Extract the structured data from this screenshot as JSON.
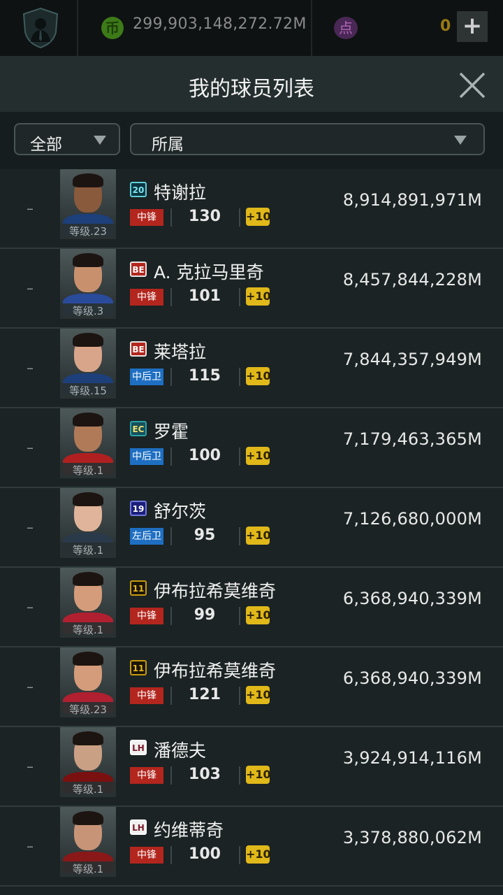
{
  "topbar": {
    "coin_icon_label": "币",
    "coin_value": "299,903,148,272.72M",
    "point_icon_label": "点",
    "point_value": "0",
    "add_label": "+"
  },
  "header": {
    "title": "我的球员列表"
  },
  "filters": {
    "scope_label": "全部",
    "team_label": "所属"
  },
  "icons": {
    "close": "close-icon",
    "dropdown": "triangle-down-icon",
    "profile": "manager-badge-icon"
  },
  "colors": {
    "forward_badge": "#b3261e",
    "defender_badge": "#1e6fc2",
    "upgrade_badge": "#e0b81a"
  },
  "players": [
    {
      "rank": "–",
      "level": "等级.23",
      "season": "20",
      "name": "特谢拉",
      "position": "中锋",
      "position_type": "fw",
      "ovr": "130",
      "upgrade": "+10",
      "value": "8,914,891,971M"
    },
    {
      "rank": "–",
      "level": "等级.3",
      "season": "BE",
      "name": "A. 克拉马里奇",
      "position": "中锋",
      "position_type": "fw",
      "ovr": "101",
      "upgrade": "+10",
      "value": "8,457,844,228M"
    },
    {
      "rank": "–",
      "level": "等级.15",
      "season": "BE",
      "name": "莱塔拉",
      "position": "中后卫",
      "position_type": "df",
      "ovr": "115",
      "upgrade": "+10",
      "value": "7,844,357,949M"
    },
    {
      "rank": "–",
      "level": "等级.1",
      "season": "EC",
      "name": "罗霍",
      "position": "中后卫",
      "position_type": "df",
      "ovr": "100",
      "upgrade": "+10",
      "value": "7,179,463,365M"
    },
    {
      "rank": "–",
      "level": "等级.1",
      "season": "19",
      "name": "舒尔茨",
      "position": "左后卫",
      "position_type": "df",
      "ovr": "95",
      "upgrade": "+10",
      "value": "7,126,680,000M"
    },
    {
      "rank": "–",
      "level": "等级.1",
      "season": "11",
      "name": "伊布拉希莫维奇",
      "position": "中锋",
      "position_type": "fw",
      "ovr": "99",
      "upgrade": "+10",
      "value": "6,368,940,339M"
    },
    {
      "rank": "–",
      "level": "等级.23",
      "season": "11",
      "name": "伊布拉希莫维奇",
      "position": "中锋",
      "position_type": "fw",
      "ovr": "121",
      "upgrade": "+10",
      "value": "6,368,940,339M"
    },
    {
      "rank": "–",
      "level": "等级.1",
      "season": "LH",
      "name": "潘德夫",
      "position": "中锋",
      "position_type": "fw",
      "ovr": "103",
      "upgrade": "+10",
      "value": "3,924,914,116M"
    },
    {
      "rank": "–",
      "level": "等级.1",
      "season": "LH",
      "name": "约维蒂奇",
      "position": "中锋",
      "position_type": "fw",
      "ovr": "100",
      "upgrade": "+10",
      "value": "3,378,880,062M"
    }
  ]
}
